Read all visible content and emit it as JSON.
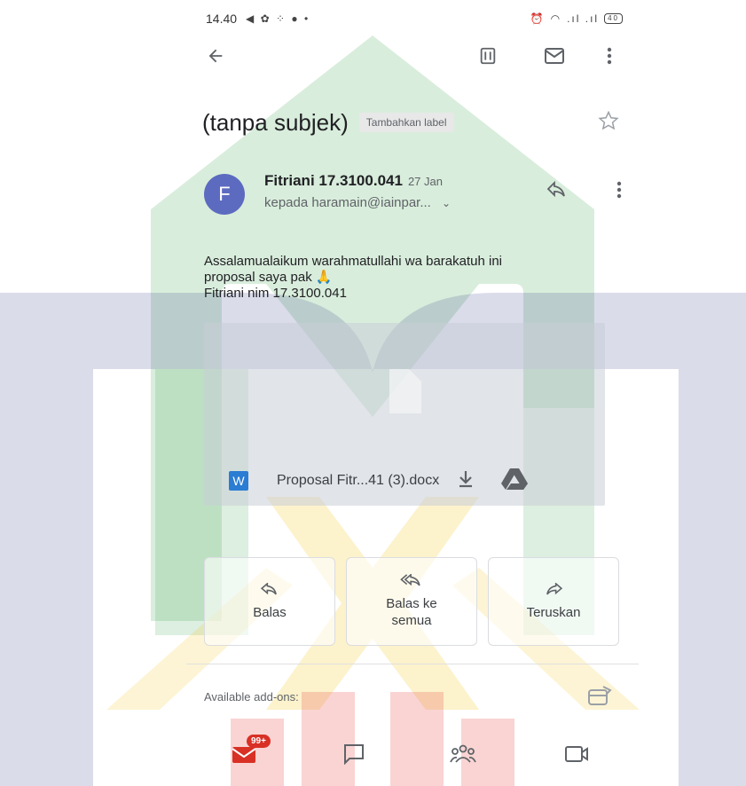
{
  "status_bar": {
    "time": "14.40",
    "battery": "40"
  },
  "email": {
    "subject": "(tanpa subjek)",
    "label_chip": "Tambahkan label",
    "sender_name": "Fitriani 17.3100.041",
    "date": "27 Jan",
    "recipient": "kepada haramain@iainpar...",
    "avatar_letter": "F",
    "body_line1": "Assalamualaikum warahmatullahi wa barakatuh ini",
    "body_line2": "proposal saya pak 🙏",
    "body_line3": "Fitriani nim 17.3100.041"
  },
  "attachment": {
    "filename": "Proposal Fitr...41 (3).docx",
    "type_letter": "W"
  },
  "actions": {
    "reply": "Balas",
    "reply_all": "Balas ke semua",
    "forward": "Teruskan"
  },
  "addons": {
    "label": "Available add-ons:"
  },
  "bottom_nav": {
    "mail_badge": "99+"
  },
  "colors": {
    "avatar": "#5c6bc0",
    "badge": "#d93025",
    "word": "#2b7cd3",
    "watermark_green": "#2e9b3e",
    "watermark_yellow": "#f3c316",
    "watermark_red": "#e53935",
    "watermark_navy": "#1a237e"
  }
}
